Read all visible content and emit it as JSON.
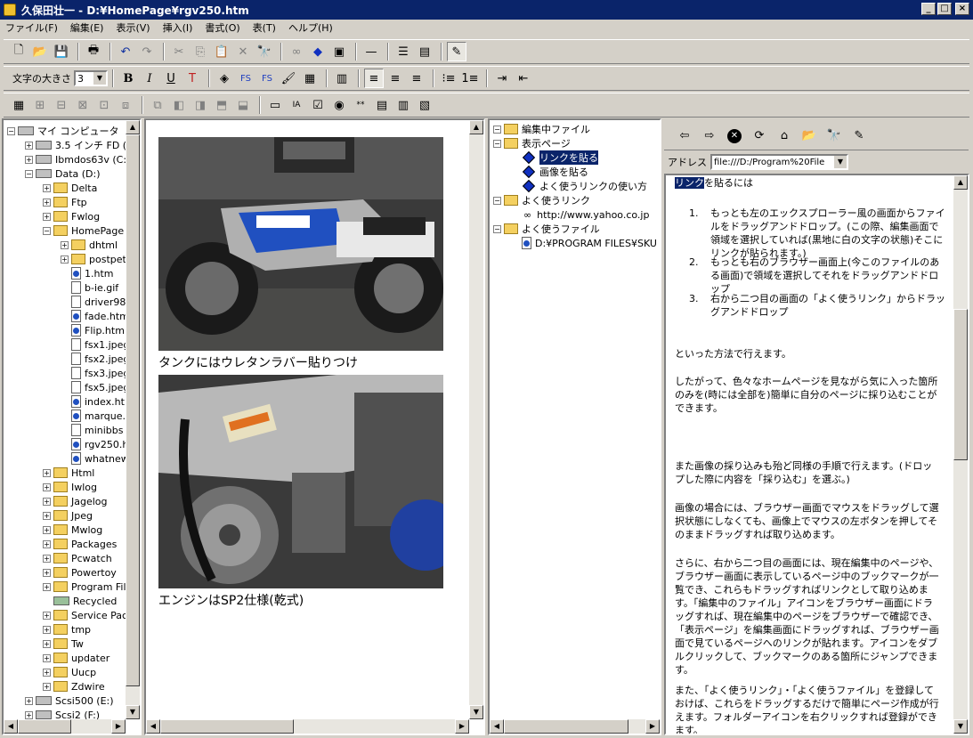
{
  "window": {
    "title": "久保田壮一 - D:¥HomePage¥rgv250.htm",
    "min": "_",
    "max": "□",
    "close": "×"
  },
  "menu": [
    "ファイル(F)",
    "編集(E)",
    "表示(V)",
    "挿入(I)",
    "書式(O)",
    "表(T)",
    "ヘルプ(H)"
  ],
  "format_toolbar": {
    "font_size_label": "文字の大きさ",
    "font_size_value": "3",
    "bold": "B",
    "italic": "I",
    "underline": "U"
  },
  "tree": {
    "items": [
      {
        "label": "マイ コンピュータ",
        "kind": "pc",
        "indent": 0,
        "pm": "-"
      },
      {
        "label": "3.5 インチ FD (",
        "kind": "drive",
        "indent": 1,
        "pm": "+"
      },
      {
        "label": "Ibmdos63v (C:)",
        "kind": "drive",
        "indent": 1,
        "pm": "+"
      },
      {
        "label": "Data (D:)",
        "kind": "drive",
        "indent": 1,
        "pm": "-"
      },
      {
        "label": "Delta",
        "kind": "folder",
        "indent": 2,
        "pm": "+"
      },
      {
        "label": "Ftp",
        "kind": "folder",
        "indent": 2,
        "pm": "+"
      },
      {
        "label": "Fwlog",
        "kind": "folder",
        "indent": 2,
        "pm": "+"
      },
      {
        "label": "HomePage",
        "kind": "folder",
        "indent": 2,
        "pm": "-"
      },
      {
        "label": "dhtml",
        "kind": "folder",
        "indent": 3,
        "pm": "+"
      },
      {
        "label": "postpet",
        "kind": "folder",
        "indent": 3,
        "pm": "+"
      },
      {
        "label": "1.htm",
        "kind": "ie",
        "indent": 3,
        "pm": ""
      },
      {
        "label": "b-ie.gif",
        "kind": "file",
        "indent": 3,
        "pm": ""
      },
      {
        "label": "driver98",
        "kind": "file",
        "indent": 3,
        "pm": ""
      },
      {
        "label": "fade.htm",
        "kind": "ie",
        "indent": 3,
        "pm": ""
      },
      {
        "label": "Flip.htm",
        "kind": "ie",
        "indent": 3,
        "pm": ""
      },
      {
        "label": "fsx1.jpeg",
        "kind": "file",
        "indent": 3,
        "pm": ""
      },
      {
        "label": "fsx2.jpeg",
        "kind": "file",
        "indent": 3,
        "pm": ""
      },
      {
        "label": "fsx3.jpeg",
        "kind": "file",
        "indent": 3,
        "pm": ""
      },
      {
        "label": "fsx5.jpeg",
        "kind": "file",
        "indent": 3,
        "pm": ""
      },
      {
        "label": "index.ht",
        "kind": "ie",
        "indent": 3,
        "pm": ""
      },
      {
        "label": "marque.",
        "kind": "ie",
        "indent": 3,
        "pm": ""
      },
      {
        "label": "minibbs",
        "kind": "file",
        "indent": 3,
        "pm": ""
      },
      {
        "label": "rgv250.h",
        "kind": "ie",
        "indent": 3,
        "pm": ""
      },
      {
        "label": "whatnew",
        "kind": "ie",
        "indent": 3,
        "pm": ""
      },
      {
        "label": "Html",
        "kind": "folder",
        "indent": 2,
        "pm": "+"
      },
      {
        "label": "Iwlog",
        "kind": "folder",
        "indent": 2,
        "pm": "+"
      },
      {
        "label": "Jagelog",
        "kind": "folder",
        "indent": 2,
        "pm": "+"
      },
      {
        "label": "Jpeg",
        "kind": "folder",
        "indent": 2,
        "pm": "+"
      },
      {
        "label": "Mwlog",
        "kind": "folder",
        "indent": 2,
        "pm": "+"
      },
      {
        "label": "Packages",
        "kind": "folder",
        "indent": 2,
        "pm": "+"
      },
      {
        "label": "Pcwatch",
        "kind": "folder",
        "indent": 2,
        "pm": "+"
      },
      {
        "label": "Powertoy",
        "kind": "folder",
        "indent": 2,
        "pm": "+"
      },
      {
        "label": "Program Fil",
        "kind": "folder",
        "indent": 2,
        "pm": "+"
      },
      {
        "label": "Recycled",
        "kind": "recycle",
        "indent": 2,
        "pm": ""
      },
      {
        "label": "Service Pac",
        "kind": "folder",
        "indent": 2,
        "pm": "+"
      },
      {
        "label": "tmp",
        "kind": "folder",
        "indent": 2,
        "pm": "+"
      },
      {
        "label": "Tw",
        "kind": "folder",
        "indent": 2,
        "pm": "+"
      },
      {
        "label": "updater",
        "kind": "folder",
        "indent": 2,
        "pm": "+"
      },
      {
        "label": "Uucp",
        "kind": "folder",
        "indent": 2,
        "pm": "+"
      },
      {
        "label": "Zdwire",
        "kind": "folder",
        "indent": 2,
        "pm": "+"
      },
      {
        "label": "Scsi500 (E:)",
        "kind": "drive",
        "indent": 1,
        "pm": "+"
      },
      {
        "label": "Scsi2 (F:)",
        "kind": "drive",
        "indent": 1,
        "pm": "+"
      }
    ]
  },
  "editor": {
    "caption1": "タンクにはウレタンラバー貼りつけ",
    "caption2": "エンジンはSP2仕様(乾式)"
  },
  "bookmarks": [
    {
      "label": "編集中ファイル",
      "kind": "folder",
      "indent": 0,
      "pm": "-"
    },
    {
      "label": "表示ページ",
      "kind": "folder",
      "indent": 0,
      "pm": "-"
    },
    {
      "label": "リンクを貼る",
      "kind": "diamond",
      "indent": 1,
      "pm": "",
      "selected": true
    },
    {
      "label": "画像を貼る",
      "kind": "diamond",
      "indent": 1,
      "pm": ""
    },
    {
      "label": "よく使うリンクの使い方",
      "kind": "diamond",
      "indent": 1,
      "pm": ""
    },
    {
      "label": "よく使うリンク",
      "kind": "folder",
      "indent": 0,
      "pm": "-"
    },
    {
      "label": "http://www.yahoo.co.jp",
      "kind": "link",
      "indent": 1,
      "pm": ""
    },
    {
      "label": "よく使うファイル",
      "kind": "folder",
      "indent": 0,
      "pm": "-"
    },
    {
      "label": "D:¥PROGRAM FILES¥SKU",
      "kind": "ie",
      "indent": 1,
      "pm": ""
    }
  ],
  "browser": {
    "address_label": "アドレス",
    "address_value": "file:///D:/Program%20File",
    "heading_sel": "リンク",
    "heading_rest": "を貼るには",
    "steps": [
      "もっとも左のエックスプローラー風の画面からファイルをドラッグアンドドロップ。(この際、編集画面で領域を選択していれば(黒地に白の文字の状態)そこにリンクが貼られます。)",
      "もっとも右のブラウザー画面上(今このファイルのある画面)で領域を選択してそれをドラッグアンドドロップ",
      "右から二つ目の画面の「よく使うリンク」からドラッグアンドドロップ"
    ],
    "paragraphs": [
      "といった方法で行えます。",
      "したがって、色々なホームページを見ながら気に入った箇所のみを(時には全部を)簡単に自分のページに採り込むことができます。",
      "また画像の採り込みも殆ど同様の手順で行えます。(ドロップした際に内容を「採り込む」を選ぶ。)",
      "画像の場合には、ブラウザー画面でマウスをドラッグして選択状態にしなくても、画像上でマウスの左ボタンを押してそのままドラッグすれば取り込めます。",
      "さらに、右から二つ目の画面には、現在編集中のページや、ブラウザー画面に表示しているページ中のブックマークが一覧でき、これらもドラッグすればリンクとして取り込めます。「編集中のファイル」アイコンをブラウザー画面にドラッグすれば、現在編集中のページをブラウザーで確認でき、「表示ページ」を編集画面にドラッグすれば、ブラウザー画面で見ているページへのリンクが貼れます。アイコンをダブルクリックして、ブックマークのある箇所にジャンプできます。",
      "また、「よく使うリンク」・「よく使うファイル」を登録しておけば、これらをドラッグするだけで簡単にページ作成が行えます。フォルダーアイコンを右クリックすれば登録ができます。"
    ]
  }
}
